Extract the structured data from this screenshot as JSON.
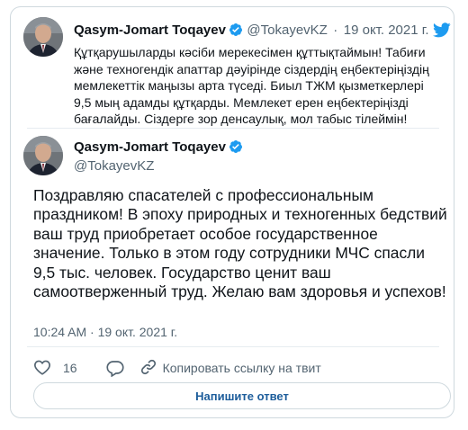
{
  "quoted": {
    "display_name": "Qasym-Jomart Toqayev",
    "handle": "@TokayevKZ",
    "separator": "·",
    "date": "19 окт. 2021 г.",
    "text": "Құтқарушыларды кәсіби мерекесімен құттықтаймын! Табиғи және техногендік апаттар дәуірінде сіздердің еңбектеріңіздің мемлекеттік маңызы арта түседі. Биыл ТЖМ қызметкерлері 9,5 мың адамды құтқарды. Мемлекет ерен еңбектеріңізді бағалайды. Сіздерге зор денсаулық, мол табыс тілеймін!"
  },
  "tweet": {
    "display_name": "Qasym-Jomart Toqayev",
    "handle": "@TokayevKZ",
    "text": "Поздравляю спасателей с профессиональным праздником! В эпоху природных и техногенных бедствий ваш труд приобретает особое государственное значение. Только в этом году сотрудники МЧС спасли 9,5 тыс. человек. Государство ценит ваш самоотверженный труд. Желаю вам здоровья и успехов!",
    "timestamp": "10:24 AM · 19 окт. 2021 г."
  },
  "actions": {
    "like_count": "16",
    "copy_link_label": "Копировать ссылку на твит"
  },
  "reply_button_label": "Напишите ответ",
  "colors": {
    "twitter_blue": "#1d9bf0",
    "verified": "#1d9bf0",
    "reply_text": "#1d5d9b",
    "secondary_text": "#536471",
    "border": "#cfd9de"
  },
  "icons": [
    "twitter-bird-icon",
    "verified-badge-icon",
    "heart-icon",
    "reply-icon",
    "link-icon"
  ]
}
